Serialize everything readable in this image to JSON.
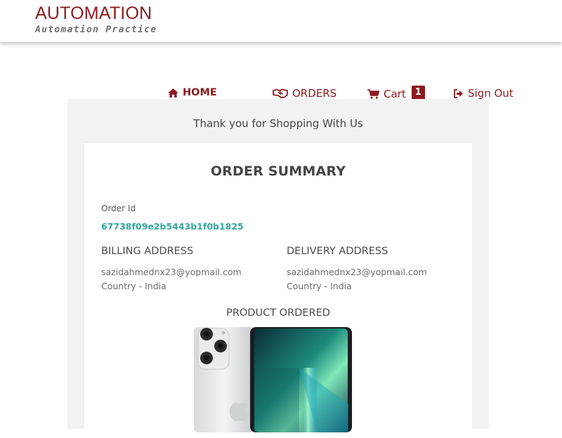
{
  "brand": {
    "title": "AUTOMATION",
    "subtitle": "Automation Practice",
    "color": "#8b1a1f"
  },
  "nav": {
    "items": [
      {
        "label": "HOME",
        "icon": "home-icon"
      },
      {
        "label": "ORDERS",
        "icon": "handshake-icon"
      },
      {
        "label": "Cart",
        "icon": "cart-icon",
        "badge": "1"
      },
      {
        "label": "Sign Out",
        "icon": "sign-out-icon"
      }
    ]
  },
  "page": {
    "thanks_message": "Thank you for Shopping With Us"
  },
  "summary": {
    "title": "ORDER SUMMARY",
    "order_id_label": "Order Id",
    "order_id": "67738f09e2b5443b1f0b1825",
    "billing": {
      "heading": "BILLING ADDRESS",
      "email": "sazidahmednx23@yopmail.com",
      "country": "Country - India"
    },
    "delivery": {
      "heading": "DELIVERY ADDRESS",
      "email": "sazidahmednx23@yopmail.com",
      "country": "Country - India"
    },
    "product_heading": "PRODUCT ORDERED",
    "product_image": "iphone-image",
    "accent_color": "#34a69a"
  }
}
